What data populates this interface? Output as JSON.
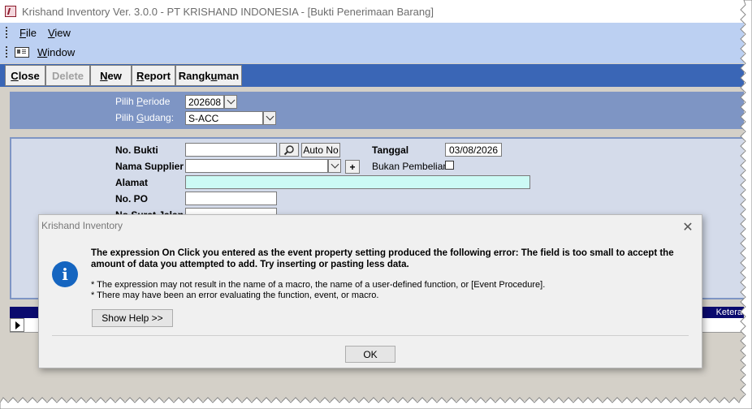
{
  "window": {
    "title": "Krishand Inventory Ver. 3.0.0 - PT KRISHAND INDONESIA - [Bukti Penerimaan Barang]"
  },
  "menu": {
    "file": {
      "accel": "F",
      "rest": "ile"
    },
    "view": {
      "accel": "V",
      "rest": "iew"
    },
    "window": {
      "accel": "W",
      "rest": "indow"
    }
  },
  "toolbar": {
    "close": {
      "accel": "C",
      "rest": "lose"
    },
    "delete": {
      "accel": "",
      "rest": "Delete"
    },
    "new": {
      "accel": "N",
      "rest": "ew"
    },
    "report": {
      "accel": "R",
      "rest": "eport"
    },
    "rangkuman": {
      "pre": "Rangk",
      "accel": "u",
      "rest": "man"
    }
  },
  "filter": {
    "periode_label_pre": "Pilih ",
    "periode_label_accel": "P",
    "periode_label_rest": "eriode",
    "periode_value": "202608",
    "gudang_label_pre": "Pilih ",
    "gudang_label_accel": "G",
    "gudang_label_rest": "udang:",
    "gudang_value": "S-ACC"
  },
  "form": {
    "no_bukti_label": "No. Bukti",
    "no_bukti_value": "",
    "auto_no_label": "Auto No",
    "tanggal_label": "Tanggal",
    "tanggal_value": "03/08/2026",
    "nama_supplier_label": "Nama Supplier",
    "add_button_label": "+",
    "bukan_pembelian_label": "Bukan Pembelian",
    "alamat_label": "Alamat",
    "no_po_label": "No. PO",
    "no_surat_jalan_label": "No Surat Jalan"
  },
  "subform": {
    "column_ket": "Ketera"
  },
  "dialog": {
    "title": "Krishand Inventory",
    "message": "The expression On Click you entered as the event property setting produced the following error: The field is too small to accept the amount of data you attempted to add.  Try inserting or pasting less data.",
    "detail_1": "* The expression may not result in the name of a macro, the name of a user-defined function, or [Event Procedure].",
    "detail_2": "* There may have been an error evaluating the function, event, or macro.",
    "show_help": "Show Help >>",
    "ok": "OK",
    "close_glyph": "✕",
    "info_glyph": "i"
  },
  "colors": {
    "menubar": "#bcd0f2",
    "toolbar": "#3a66b6",
    "panel": "#7e95c4",
    "dialog_icon": "#1565c0"
  }
}
